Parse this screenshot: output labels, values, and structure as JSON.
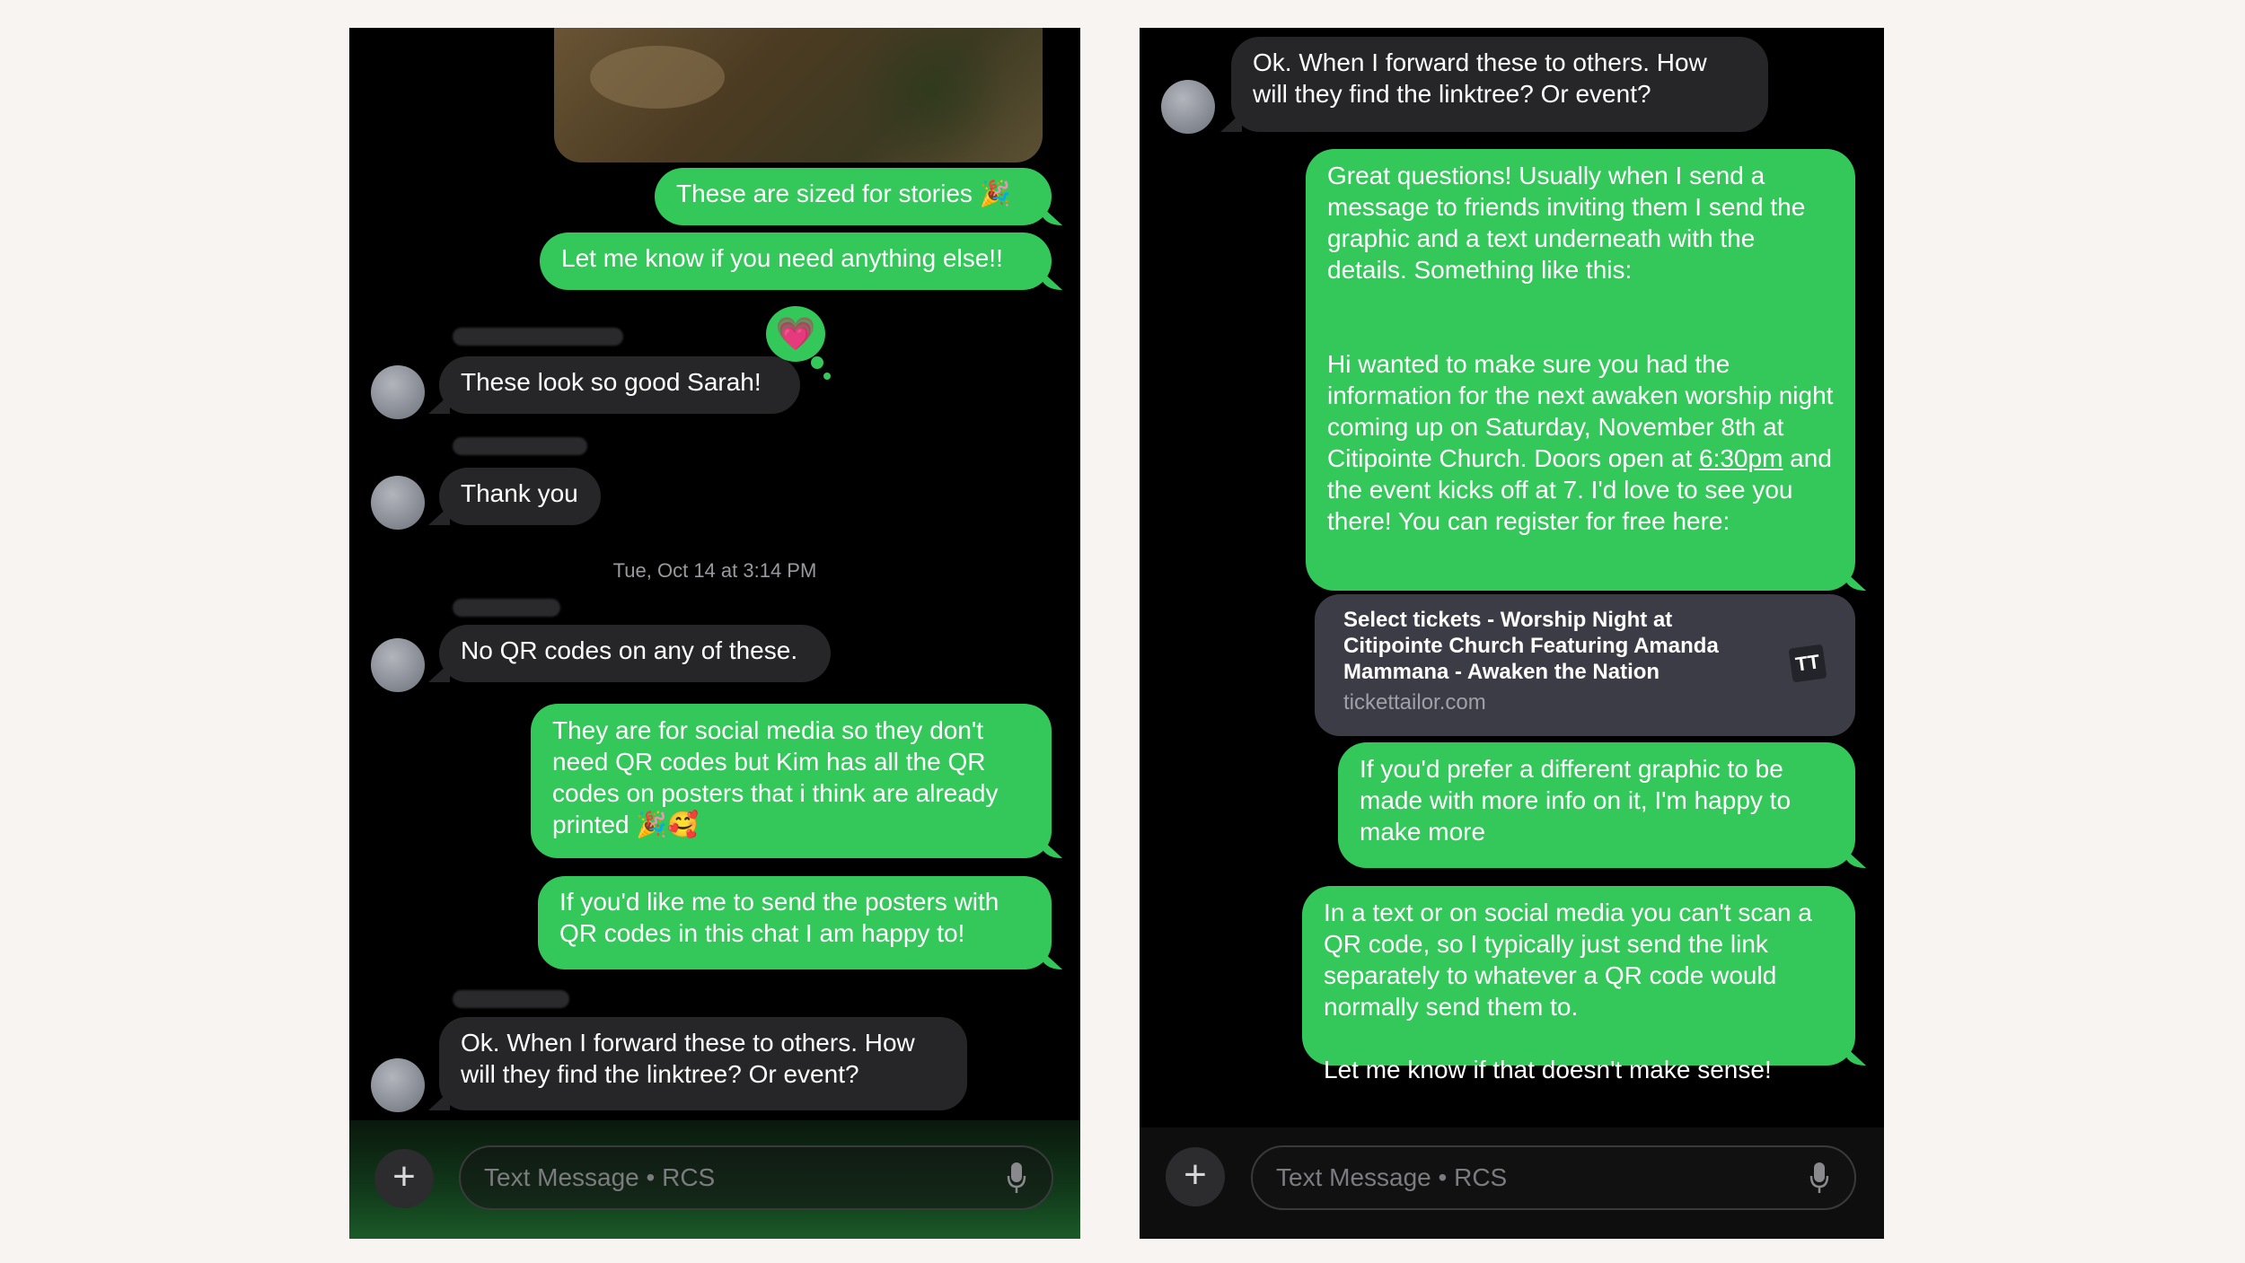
{
  "left": {
    "messages": {
      "m1": "These are sized for stories 🎉",
      "m2": "Let me know if you need anything else!!",
      "m3": "These look so good Sarah!",
      "m4": "Thank you",
      "m5": "No QR codes on any of these.",
      "m6": "They are for social media so they don't need QR codes but Kim has all the QR codes on posters that i think are already printed 🎉🥰",
      "m7": "If you'd like me to send the posters with QR codes in this chat I am happy to!",
      "m8": "Ok. When I forward these to others. How will they find the linktree? Or event?"
    },
    "reaction": "💗",
    "timestamp": "Tue, Oct 14 at 3:14 PM",
    "input_placeholder": "Text Message • RCS"
  },
  "right": {
    "messages": {
      "m1": "Ok. When I forward these to others. How will they find the linktree? Or event?",
      "m2_para1": "Great questions! Usually when I send a message to friends inviting them I send the graphic and a text underneath with the details. Something like this:",
      "m2_para2_a": "Hi wanted to make sure you had the information for the next awaken worship night coming up on Saturday, November 8th at Citipointe Church. Doors open at ",
      "m2_para2_link": "6:30pm",
      "m2_para2_b": " and the event kicks off at 7. I'd love to see you there! You can register for free here:",
      "m3": "If you'd prefer a different graphic to be made with more info on it, I'm happy to make more",
      "m4_para1": "In a text or on social media you can't scan a QR code, so I typically just send the link separately to whatever a QR code would normally send them to.",
      "m4_para2": "Let me know if that doesn't make sense!"
    },
    "link_card": {
      "title": "Select tickets - Worship Night at Citipointe Church Featuring Amanda Mammana - Awaken the Nation",
      "domain": "tickettailor.com",
      "logo": "TT"
    },
    "input_placeholder": "Text Message • RCS"
  },
  "colors": {
    "sent_bubble": "#34c759",
    "received_bubble": "#262628",
    "background": "#f8f4f1"
  },
  "icons": [
    "plus-icon",
    "microphone-icon",
    "heart-icon",
    "avatar-icon",
    "tickettailor-logo-icon"
  ]
}
